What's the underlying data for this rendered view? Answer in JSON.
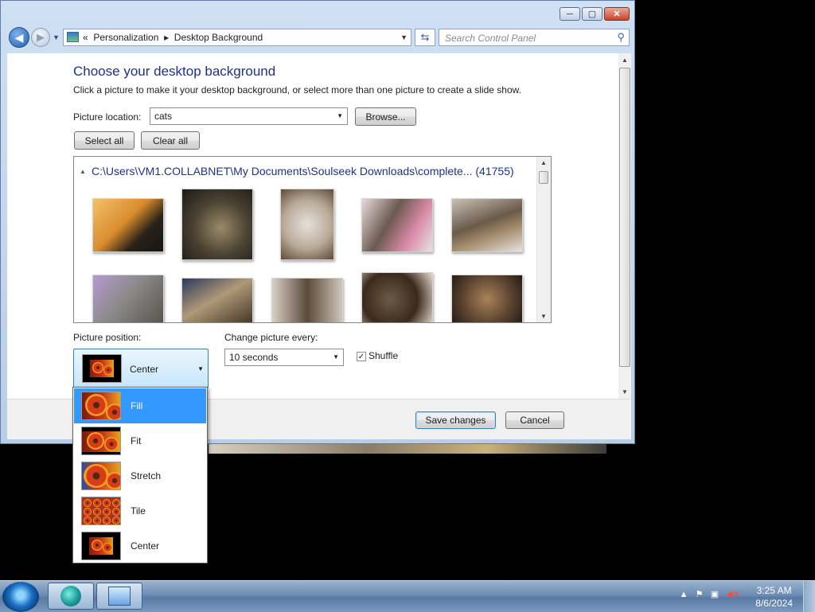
{
  "window": {
    "caption_buttons": [
      "─",
      "▢",
      "✕"
    ]
  },
  "navbar": {
    "back": "◀",
    "forward": "▶",
    "address_prefix": "«",
    "breadcrumb": [
      "Personalization",
      "Desktop Background"
    ],
    "breadcrumb_sep": "▸",
    "search_placeholder": "Search Control Panel"
  },
  "page": {
    "title": "Choose your desktop background",
    "subtitle": "Click a picture to make it your desktop background, or select more than one picture to create a slide show.",
    "picture_location_label": "Picture location:",
    "picture_location_value": "cats",
    "browse_label": "Browse...",
    "select_all_label": "Select all",
    "clear_all_label": "Clear all"
  },
  "gallery": {
    "group_header": "C:\\Users\\VM1.COLLABNET\\My Documents\\Soulseek Downloads\\complete... (41755)"
  },
  "options": {
    "picture_position_label": "Picture position:",
    "picture_position_value": "Center",
    "change_every_label": "Change picture every:",
    "change_every_value": "10 seconds",
    "shuffle_label": "Shuffle",
    "shuffle_checked": true
  },
  "footer": {
    "save_label": "Save changes",
    "cancel_label": "Cancel"
  },
  "dropdown": {
    "items": [
      {
        "label": "Fill",
        "selected": true
      },
      {
        "label": "Fit",
        "selected": false
      },
      {
        "label": "Stretch",
        "selected": false
      },
      {
        "label": "Tile",
        "selected": false
      },
      {
        "label": "Center",
        "selected": false
      }
    ]
  },
  "taskbar": {
    "time": "3:25 AM",
    "date": "8/6/2024"
  },
  "colors": {
    "accent": "#3399ff",
    "title": "#1e3287"
  }
}
